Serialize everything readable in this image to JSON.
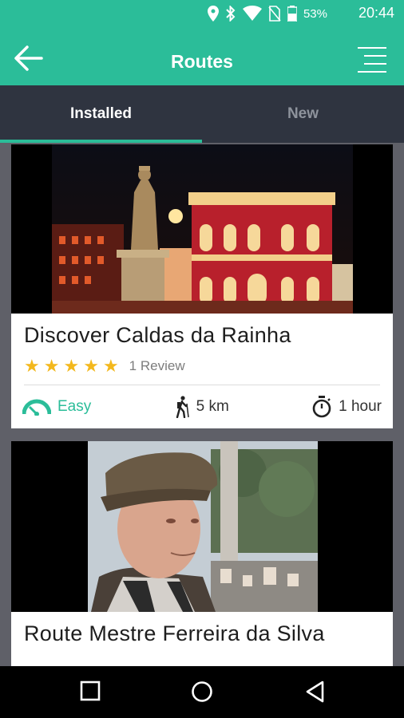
{
  "status_bar": {
    "battery_percent": "53%",
    "time": "20:44",
    "icons": [
      "location-icon",
      "bluetooth-icon",
      "wifi-icon",
      "no-sim-icon",
      "battery-icon"
    ]
  },
  "app_bar": {
    "title": "Routes",
    "back_icon": "arrow-left-icon",
    "menu_icon": "menu-icon"
  },
  "tabs": [
    {
      "label": "Installed",
      "active": true
    },
    {
      "label": "New",
      "active": false
    }
  ],
  "routes": [
    {
      "title": "Discover Caldas da Rainha",
      "rating": 5,
      "review_text": "1 Review",
      "difficulty": "Easy",
      "distance": "5 km",
      "duration": "1 hour"
    },
    {
      "title": "Route Mestre Ferreira da Silva"
    }
  ],
  "colors": {
    "accent": "#2bbd99",
    "tab_bar": "#2f3440",
    "star": "#f3b81d",
    "background": "#5f6068"
  }
}
